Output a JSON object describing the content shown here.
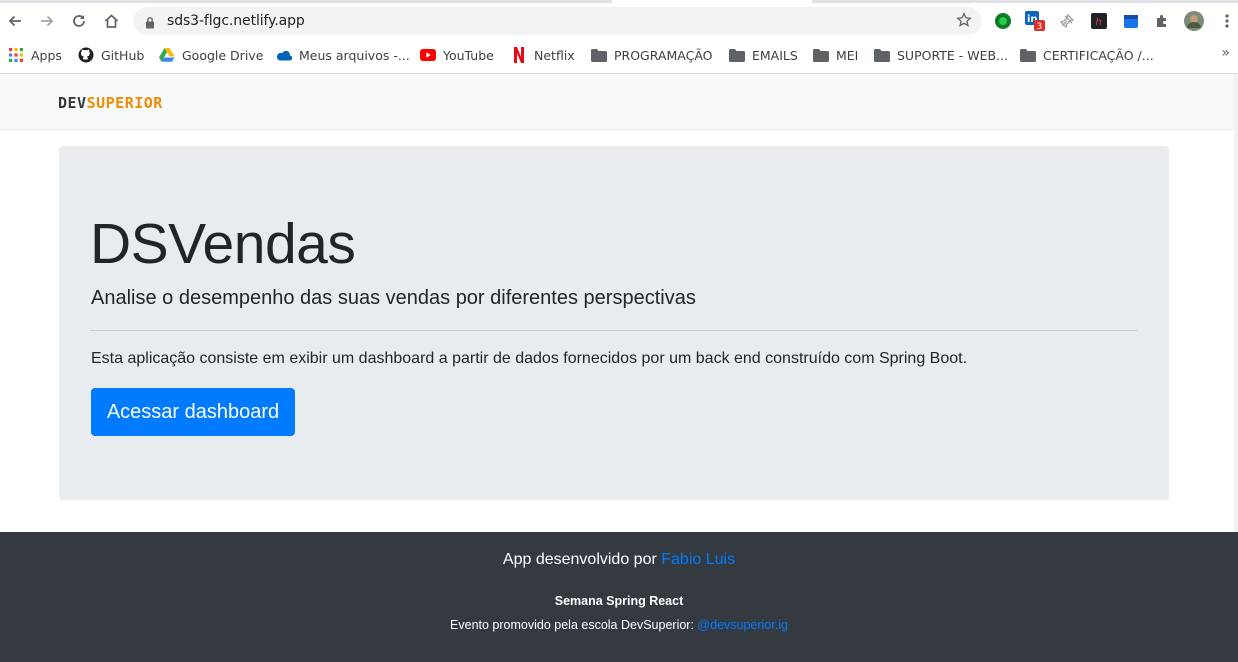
{
  "browser": {
    "url": "sds3-flgc.netlify.app",
    "bookmarks": [
      {
        "label": "Apps",
        "icon": "apps-grid-icon"
      },
      {
        "label": "GitHub",
        "icon": "github-icon"
      },
      {
        "label": "Google Drive",
        "icon": "google-drive-icon"
      },
      {
        "label": "Meus arquivos -...",
        "icon": "onedrive-icon"
      },
      {
        "label": "YouTube",
        "icon": "youtube-icon"
      },
      {
        "label": "Netflix",
        "icon": "netflix-icon"
      },
      {
        "label": "PROGRAMAÇÃO",
        "icon": "folder-icon"
      },
      {
        "label": "EMAILS",
        "icon": "folder-icon"
      },
      {
        "label": "MEI",
        "icon": "folder-icon"
      },
      {
        "label": "SUPORTE - WEB...",
        "icon": "folder-icon"
      },
      {
        "label": "CERTIFICAÇÃO /...",
        "icon": "folder-icon"
      }
    ],
    "more_bookmarks": "»",
    "extension_badge": "3"
  },
  "navbar": {
    "logo_dev": "DEV",
    "logo_superior": "SUPERIOR"
  },
  "hero": {
    "title": "DSVendas",
    "lead": "Analise o desempenho das suas vendas por diferentes perspectivas",
    "description": "Esta aplicação consiste em exibir um dashboard a partir de dados fornecidos por um back end construído com Spring Boot.",
    "button_label": "Acessar dashboard"
  },
  "footer": {
    "developed_by": "App desenvolvido por",
    "developer_name": "Fabio Luis",
    "event_title": "Semana Spring React",
    "event_text": "Evento promovido pela escola DevSuperior:",
    "event_link": "@devsuperior.ig"
  },
  "colors": {
    "primary": "#007bff",
    "brand_orange": "#f08c00",
    "footer_bg": "#343a40",
    "jumbotron_bg": "#e9ecef"
  }
}
